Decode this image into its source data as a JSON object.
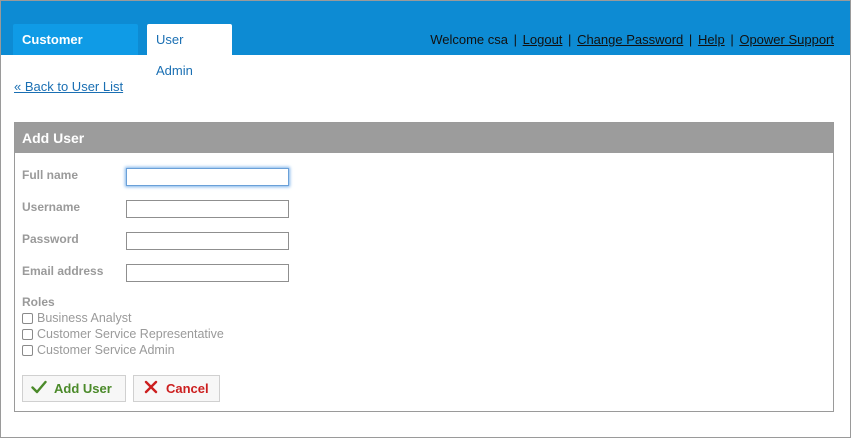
{
  "header": {
    "tabs": [
      {
        "label": "Customer Service"
      },
      {
        "label": "User Admin"
      }
    ],
    "welcome": "Welcome csa",
    "links": {
      "logout": "Logout",
      "change_password": "Change Password",
      "help": "Help",
      "support": "Opower Support"
    },
    "separator": "|"
  },
  "back_link": "« Back to User List",
  "panel": {
    "title": "Add User",
    "fields": {
      "full_name": {
        "label": "Full name",
        "value": ""
      },
      "username": {
        "label": "Username",
        "value": ""
      },
      "password": {
        "label": "Password",
        "value": ""
      },
      "email": {
        "label": "Email address",
        "value": ""
      }
    },
    "roles_title": "Roles",
    "roles": [
      {
        "label": "Business Analyst",
        "checked": false
      },
      {
        "label": "Customer Service Representative",
        "checked": false
      },
      {
        "label": "Customer Service Admin",
        "checked": false
      }
    ],
    "buttons": {
      "add": "Add User",
      "cancel": "Cancel"
    }
  },
  "colors": {
    "topbar": "#0d8bd3",
    "active_tab": "#0f9be6",
    "panel_header": "#9c9c9c",
    "add_green": "#4b8a2a",
    "cancel_red": "#cc1f1f"
  },
  "icons": {
    "add": "checkmark-icon",
    "cancel": "x-icon"
  }
}
